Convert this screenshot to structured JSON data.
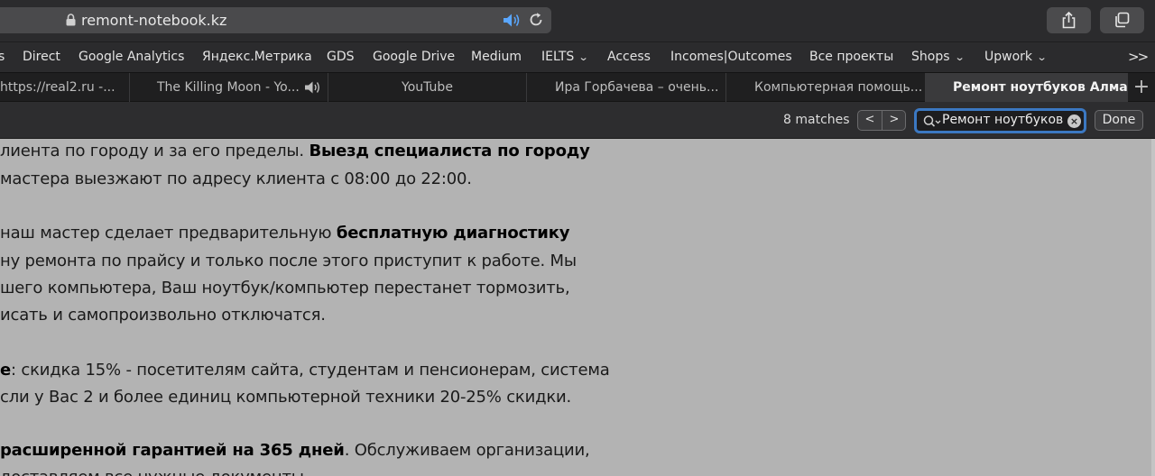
{
  "toolbar": {
    "url": "remont-notebook.kz"
  },
  "bookmarks": [
    {
      "label": "s"
    },
    {
      "label": "Direct"
    },
    {
      "label": "Google Analytics"
    },
    {
      "label": "Яндекс.Метрика"
    },
    {
      "label": "GDS"
    },
    {
      "label": "Google Drive"
    },
    {
      "label": "Medium"
    },
    {
      "label": "IELTS",
      "chevron": "⌄"
    },
    {
      "label": "Access"
    },
    {
      "label": "Incomes|Outcomes"
    },
    {
      "label": "Все проекты"
    },
    {
      "label": "Shops",
      "chevron": "⌄"
    },
    {
      "label": "Upwork",
      "chevron": "⌄"
    }
  ],
  "bookmarks_more": ">>",
  "tabs": [
    {
      "label": "https://real2.ru -..."
    },
    {
      "label": "The Killing Moon - Yo..."
    },
    {
      "label": "YouTube"
    },
    {
      "label": "Ира Горбачева – очень..."
    },
    {
      "label": "Компьютерная помощь..."
    },
    {
      "label": "Ремонт ноутбуков Алма..."
    }
  ],
  "new_tab": "+",
  "findbar": {
    "matches": "8 matches",
    "prev": "<",
    "next": ">",
    "query": "Ремонт ноутбуков",
    "clear": "×",
    "done": "Done"
  },
  "content": {
    "l1_a": "лиента по городу и за его пределы. ",
    "l1_b": "Выезд специалиста по городу",
    "l2": "мастера выезжают по адресу клиента с 08:00 до 22:00.",
    "l3_a": " наш мастер сделает предварительную ",
    "l3_b": "бесплатную диагностику",
    "l4": "ну ремонта по прайсу и только после этого приступит к работе. Мы",
    "l5": "шего компьютера, Ваш ноутбук/компьютер перестанет тормозить,",
    "l6": "исать и самопроизвольно отключатся.",
    "l7_a": "е",
    "l7_b": ": скидка 15% - посетителям сайта, студентам и пенсионерам, система",
    "l8": "сли у Вас 2 и более единиц компьютерной техники 20-25% скидки.",
    "l9_a": " расширенной гарантией на 365 дней",
    "l9_b": ". Обслуживаем организации,",
    "l10": "доставляем все нужные документы."
  },
  "colors": {
    "chrome_bg": "#2b2b2d",
    "find_highlight": "#3b78c2",
    "page_bg": "#b3b3b3",
    "speaker_blue": "#5aa7ff"
  }
}
